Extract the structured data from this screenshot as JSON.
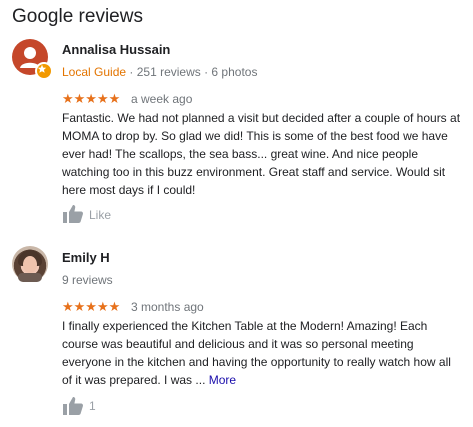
{
  "section_title": "Google reviews",
  "reviews": [
    {
      "author": "Annalisa Hussain",
      "badge": "Local Guide",
      "separator": " · ",
      "stats": "251 reviews · 6 photos",
      "rating": "★★★★★",
      "time_ago": "a week ago",
      "text": "Fantastic. We had not planned a visit but decided after a couple of hours at MOMA to drop by. So glad we did! This is some of the best food we have ever had! The scallops, the sea bass... great wine. And nice people watching too in this buzz environment. Great staff and service. Would sit here most days if I could!",
      "like_label": "Like"
    },
    {
      "author": "Emily H",
      "stats": "9 reviews",
      "rating": "★★★★★",
      "time_ago": "3 months ago",
      "text": "I finally experienced the Kitchen Table at the Modern!  Amazing! Each course was beautiful and delicious and it was so personal meeting everyone in the kitchen and having the opportunity to really watch how all of it was prepared. I was ...",
      "more_label": "More",
      "like_count": "1"
    }
  ],
  "colors": {
    "star": "#e7711b",
    "local_guide": "#e37400",
    "link": "#1a0dab",
    "muted": "#70757a"
  },
  "icons": [
    "thumbs-up-icon",
    "local-guide-badge-icon",
    "user-silhouette-icon"
  ]
}
